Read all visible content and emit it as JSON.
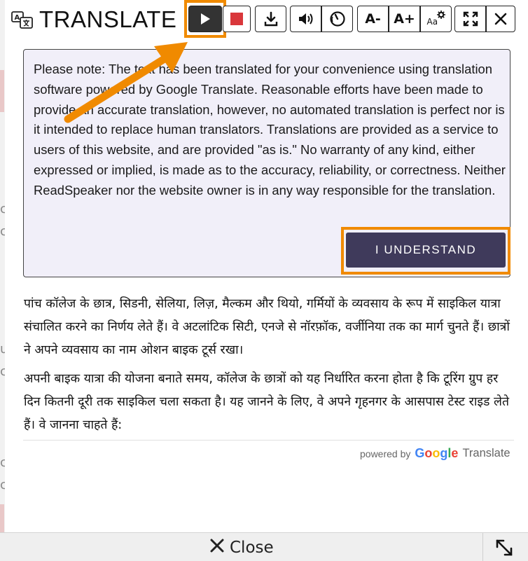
{
  "header": {
    "title": "TRANSLATE"
  },
  "toolbar": {
    "play": "play-icon",
    "stop": "stop-icon",
    "download": "download-icon",
    "volume": "volume-icon",
    "speed": "speed-icon",
    "font_decrease_label": "A-",
    "font_increase_label": "A+",
    "font_settings_label": "Aa",
    "fullscreen": "fullscreen-icon",
    "close": "close-icon"
  },
  "notice": {
    "text": "Please note: The text has been translated for your convenience using translation software powered by Google Translate. Reasonable efforts have been made to provide an accurate translation, however, no automated translation is perfect nor is it intended to replace human translators. Translations are provided as a service to users of this website, and are provided \"as is.\" No warranty of any kind, either expressed or implied, is made as to the accuracy, reliability, or correctness. Neither ReadSpeaker nor the website owner is in any way responsible for the translation.",
    "button_label": "I UNDERSTAND"
  },
  "content": {
    "paragraphs": [
      "पांच कॉलेज के छात्र, सिडनी, सेलिया, लिज़, मैल्कम और थियो, गर्मियों के व्यवसाय के रूप में साइकिल यात्रा संचालित करने का निर्णय लेते हैं। वे अटलांटिक सिटी, एनजे से नॉरफ़ॉक, वर्जीनिया तक का मार्ग चुनते हैं। छात्रों ने अपने व्यवसाय का नाम ओशन बाइक टूर्स रखा।",
      "अपनी बाइक यात्रा की योजना बनाते समय, कॉलेज के छात्रों को यह निर्धारित करना होता है कि टूरिंग ग्रुप हर दिन कितनी दूरी तक साइकिल चला सकता है। यह जानने के लिए, वे अपने गृहनगर के आसपास टेस्ट राइड लेते हैं। वे जानना चाहते हैं:"
    ]
  },
  "powered_by": {
    "prefix": "powered by",
    "google_letters": [
      "G",
      "o",
      "o",
      "g",
      "l",
      "e"
    ],
    "google_colors": [
      "#4285F4",
      "#EA4335",
      "#FBBC05",
      "#4285F4",
      "#34A853",
      "#EA4335"
    ],
    "suffix": "Translate"
  },
  "footer": {
    "close_label": "Close",
    "resize": "resize-icon"
  },
  "colors": {
    "accent_orange": "#f08a00",
    "button_dark": "#3f3a5b",
    "stop_red": "#d9373b",
    "notice_bg": "#f1eff9"
  }
}
